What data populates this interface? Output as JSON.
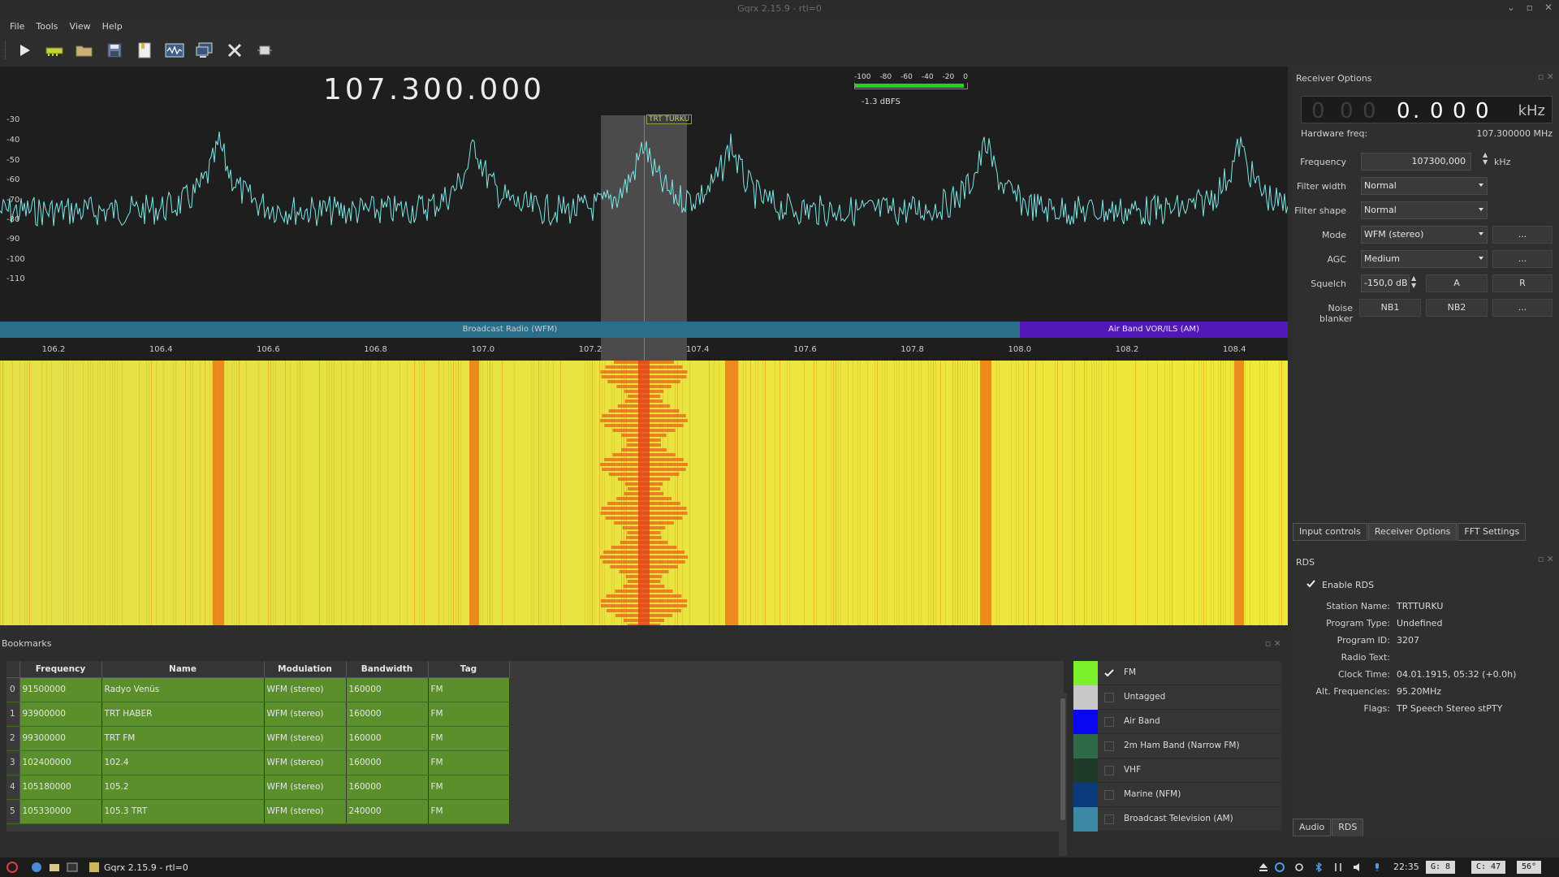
{
  "window": {
    "title": "Gqrx 2.15.9 - rtl=0",
    "buttons": [
      "⌄",
      "▫",
      "✕"
    ]
  },
  "menu": [
    "File",
    "Tools",
    "View",
    "Help"
  ],
  "toolbar": {
    "icons": [
      "play-icon",
      "sdr-device-icon",
      "open-folder-icon",
      "save-icon",
      "bookmark-icon",
      "waveform-icon",
      "remote-control-icon",
      "settings-tools-icon",
      "chip-icon"
    ]
  },
  "plot": {
    "frequency_readout": "107.300.000",
    "meter_scale": [
      "-100",
      "-80",
      "-60",
      "-40",
      "-20",
      "0"
    ],
    "meter_level": 0.97,
    "meter_dbfs": "-1.3 dBFS",
    "y_ticks": [
      "-30",
      "-40",
      "-50",
      "-60",
      "-70",
      "-80",
      "-90",
      "-100",
      "-110"
    ],
    "x_ticks": [
      "106.2",
      "106.4",
      "106.6",
      "106.8",
      "107.0",
      "107.2",
      "107.4",
      "107.6",
      "107.8",
      "108.0",
      "108.2",
      "108.4"
    ],
    "station_tag": "TRT TURKU",
    "bands": {
      "wfm": "Broadcast Radio (WFM)",
      "air": "Air Band VOR/ILS (AM)"
    },
    "colors": {
      "spectrum": "#7fe6e6",
      "band_wfm": "#2a6e8a",
      "band_air": "#5318b8",
      "center_line": "#e05555"
    }
  },
  "bookmarks": {
    "title": "Bookmarks",
    "columns": [
      "Frequency",
      "Name",
      "Modulation",
      "Bandwidth",
      "Tag"
    ],
    "rows": [
      {
        "idx": "0",
        "freq": "91500000",
        "name": "Radyo Venüs",
        "mod": "WFM (stereo)",
        "bw": "160000",
        "tag": "FM"
      },
      {
        "idx": "1",
        "freq": "93900000",
        "name": "TRT HABER",
        "mod": "WFM (stereo)",
        "bw": "160000",
        "tag": "FM"
      },
      {
        "idx": "2",
        "freq": "99300000",
        "name": "TRT FM",
        "mod": "WFM (stereo)",
        "bw": "160000",
        "tag": "FM"
      },
      {
        "idx": "3",
        "freq": "102400000",
        "name": "102.4",
        "mod": "WFM (stereo)",
        "bw": "160000",
        "tag": "FM"
      },
      {
        "idx": "4",
        "freq": "105180000",
        "name": "105.2",
        "mod": "WFM (stereo)",
        "bw": "160000",
        "tag": "FM"
      },
      {
        "idx": "5",
        "freq": "105330000",
        "name": "105.3 TRT",
        "mod": "WFM (stereo)",
        "bw": "240000",
        "tag": "FM"
      }
    ],
    "tags": [
      {
        "label": "FM",
        "color": "#7cf02a",
        "checked": true
      },
      {
        "label": "Untagged",
        "color": "#c8c8c8",
        "checked": false
      },
      {
        "label": "Air Band",
        "color": "#0a08f0",
        "checked": false
      },
      {
        "label": "2m Ham Band (Narrow FM)",
        "color": "#2f6a48",
        "checked": false
      },
      {
        "label": "VHF",
        "color": "#1e3a28",
        "checked": false
      },
      {
        "label": "Marine (NFM)",
        "color": "#0b3a7a",
        "checked": false
      },
      {
        "label": "Broadcast Television (AM)",
        "color": "#3e8aa6",
        "checked": false
      }
    ]
  },
  "receiver": {
    "title": "Receiver Options",
    "lcd_dim": [
      "0",
      "0",
      "0"
    ],
    "lcd_bright": [
      "0",
      ".",
      "0",
      "0",
      "0"
    ],
    "lcd_unit": "kHz",
    "hw_label": "Hardware freq:",
    "hw_value": "107.300000 MHz",
    "freq_label": "Frequency",
    "freq_value": "107300,000",
    "freq_unit": "kHz",
    "filter_width_label": "Filter width",
    "filter_width": "Normal",
    "filter_shape_label": "Filter shape",
    "filter_shape": "Normal",
    "mode_label": "Mode",
    "mode": "WFM (stereo)",
    "agc_label": "AGC",
    "agc": "Medium",
    "squelch_label": "Squelch",
    "squelch": "-150,0 dB",
    "squelch_a": "A",
    "squelch_r": "R",
    "nb_label": "Noise blanker",
    "nb1": "NB1",
    "nb2": "NB2",
    "more": "...",
    "tabs": [
      "Input controls",
      "Receiver Options",
      "FFT Settings"
    ]
  },
  "rds": {
    "title": "RDS",
    "enable_label": "Enable RDS",
    "fields": [
      {
        "k": "Station Name:",
        "v": "TRTTURKU"
      },
      {
        "k": "Program Type:",
        "v": "Undefined"
      },
      {
        "k": "Program ID:",
        "v": "3207"
      },
      {
        "k": "Radio Text:",
        "v": ""
      },
      {
        "k": "Clock Time:",
        "v": "04.01.1915, 05:32 (+0.0h)"
      },
      {
        "k": "Alt. Frequencies:",
        "v": "95.20MHz"
      },
      {
        "k": "Flags:",
        "v": "TP Speech Stereo stPTY"
      }
    ],
    "tabs": [
      "Audio",
      "RDS"
    ]
  },
  "taskbar": {
    "task_label": "Gqrx 2.15.9 - rtl=0",
    "clock": "22:35",
    "g_box": "G:  8",
    "c_box": "C: 47",
    "temp_box": "56°"
  }
}
